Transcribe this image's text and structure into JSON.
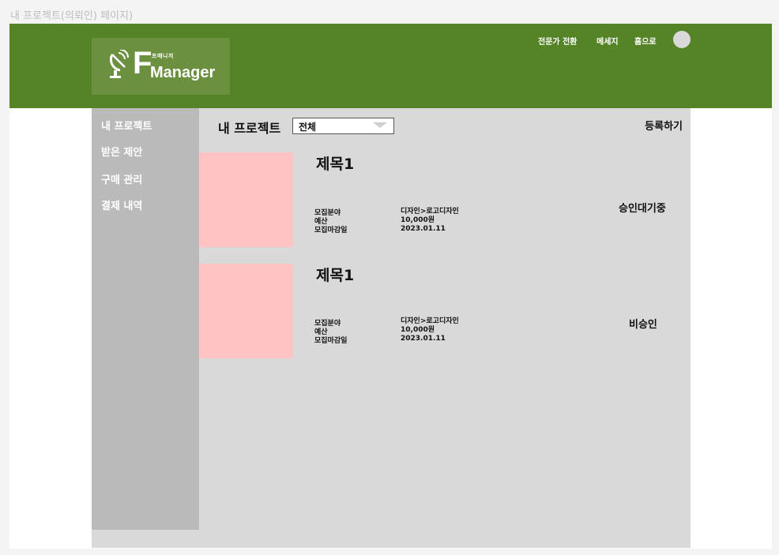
{
  "page_label": "내 프로젝트(의뢰인) 페이지)",
  "colors": {
    "header_bg": "#548425",
    "logo_bg": "#6b9140",
    "sidebar_bg": "#bababa",
    "content_bg": "#d9d9d9",
    "thumbnail": "#ffc3c3"
  },
  "logo": {
    "big_letter": "F",
    "small_text": "프매니저",
    "word": "Manager",
    "icon": "satellite-dish-icon"
  },
  "header": {
    "nav": [
      {
        "label": "전문가 전환"
      },
      {
        "label": "메세지"
      },
      {
        "label": "홈으로"
      }
    ],
    "avatar": "user-avatar"
  },
  "sidebar": {
    "items": [
      {
        "label": "내 프로젝트"
      },
      {
        "label": "받은 제안"
      },
      {
        "label": "구매 관리"
      },
      {
        "label": "결제 내역"
      }
    ]
  },
  "main": {
    "title": "내 프로젝트",
    "filter": {
      "selected": "전체",
      "icon": "dropdown-caret-icon"
    },
    "register_label": "등록하기",
    "field_labels": {
      "category": "모집분야",
      "budget": "예산",
      "deadline": "모집마감일"
    },
    "projects": [
      {
        "title": "제목1",
        "category": "디자인>로고디자인",
        "budget": "10,000원",
        "deadline": "2023.01.11",
        "status": "승인대기중"
      },
      {
        "title": "제목1",
        "category": "디자인>로고디자인",
        "budget": "10,000원",
        "deadline": "2023.01.11",
        "status": "비승인"
      }
    ]
  }
}
